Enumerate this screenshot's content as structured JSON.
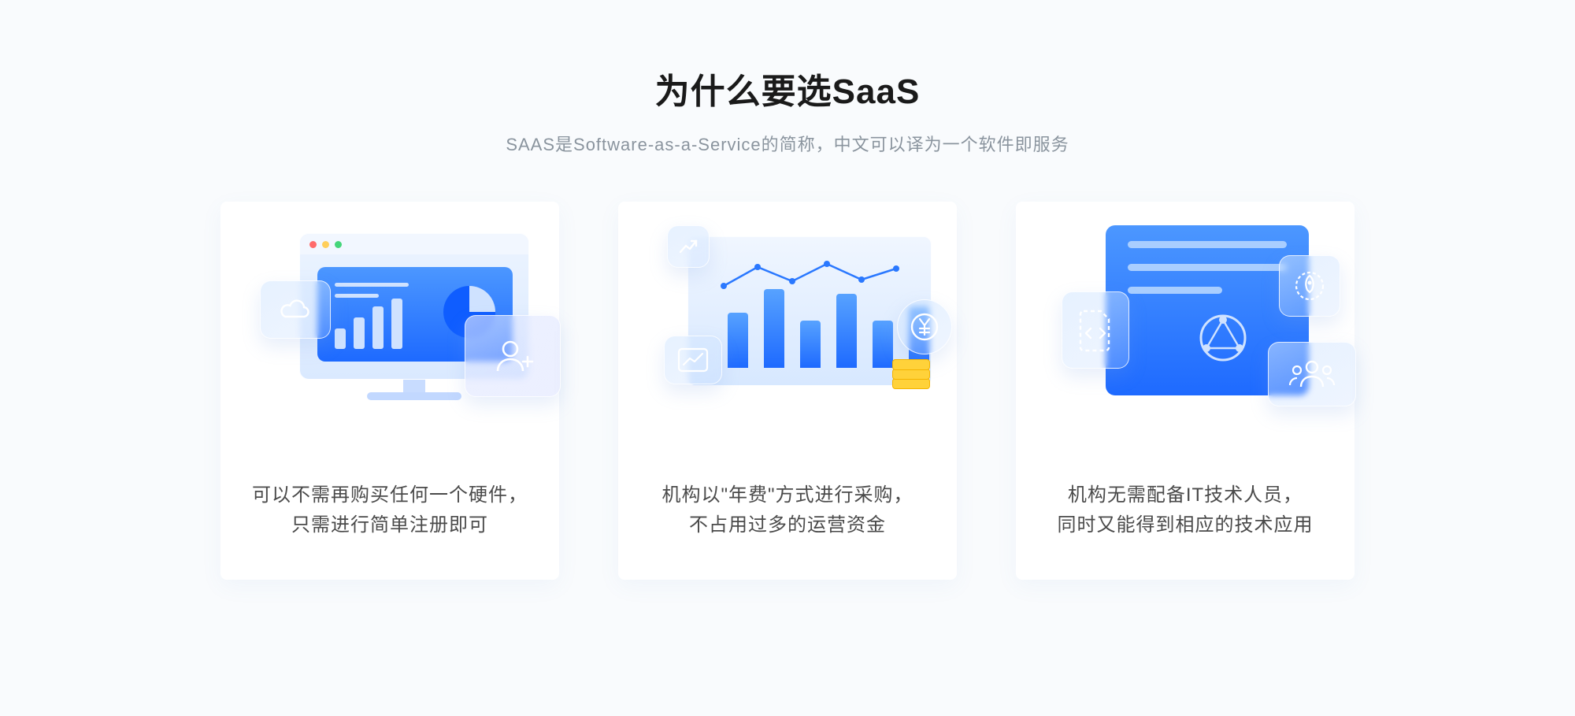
{
  "heading": {
    "title": "为什么要选SaaS",
    "subtitle": "SAAS是Software-as-a-Service的简称，中文可以译为一个软件即服务"
  },
  "cards": [
    {
      "line1": "可以不需再购买任何一个硬件，",
      "line2": "只需进行简单注册即可"
    },
    {
      "line1": "机构以\"年费\"方式进行采购，",
      "line2": "不占用过多的运营资金"
    },
    {
      "line1": "机构无需配备IT技术人员，",
      "line2": "同时又能得到相应的技术应用"
    }
  ]
}
